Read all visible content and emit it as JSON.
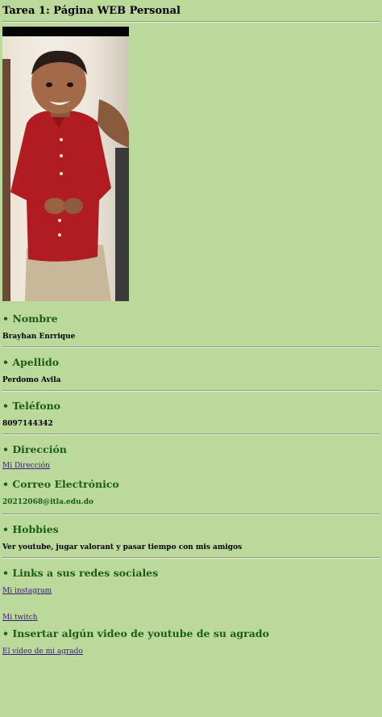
{
  "page": {
    "title": "Tarea 1: Página WEB Personal"
  },
  "photo": {
    "alt": ""
  },
  "sections": {
    "nombre": {
      "heading": "• Nombre",
      "value": "Brayhan Enrrique"
    },
    "apellido": {
      "heading": "• Apellido",
      "value": "Perdomo Avila"
    },
    "telefono": {
      "heading": "• Teléfono",
      "value": "8097144342"
    },
    "direccion": {
      "heading": "• Dirección",
      "link": "Mi Dirección"
    },
    "correo": {
      "heading": "• Correo Electrónico",
      "value": "20212068@itla.edu.do"
    },
    "hobbies": {
      "heading": "• Hobbies",
      "value": "Ver youtube, jugar valorant y pasar tiempo con mis amigos"
    },
    "redes": {
      "heading": "• Links a sus redes sociales",
      "link1": "Mi instagram",
      "link2": "Mi twitch"
    },
    "video": {
      "heading": "• Insertar algún video de youtube de su agrado",
      "link": "El video de mi agrado"
    }
  },
  "colors": {
    "background": "#bcd99c",
    "heading": "#1a5c1a",
    "link": "#3b1a7c"
  }
}
